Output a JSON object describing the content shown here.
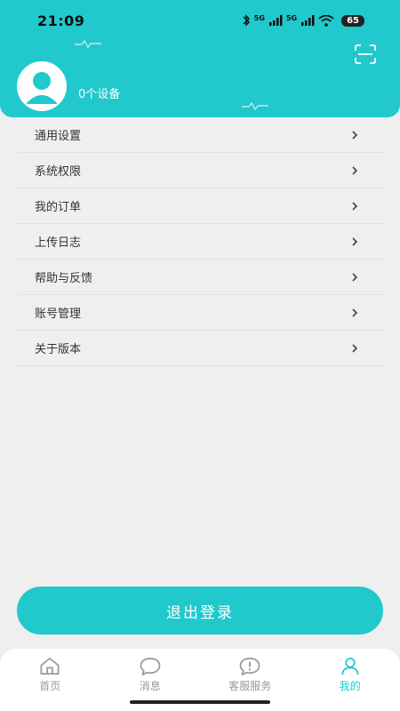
{
  "status_bar": {
    "time": "21:09",
    "signal": "5G",
    "battery": "65"
  },
  "profile": {
    "device_count": "0个设备"
  },
  "menu": {
    "items": [
      {
        "label": "通用设置"
      },
      {
        "label": "系统权限"
      },
      {
        "label": "我的订单"
      },
      {
        "label": "上传日志"
      },
      {
        "label": "帮助与反馈"
      },
      {
        "label": "账号管理"
      },
      {
        "label": "关于版本"
      }
    ]
  },
  "logout_label": "退出登录",
  "tabs": [
    {
      "label": "首页",
      "icon": "home-icon"
    },
    {
      "label": "消息",
      "icon": "message-icon"
    },
    {
      "label": "客服服务",
      "icon": "support-icon"
    },
    {
      "label": "我的",
      "icon": "profile-icon",
      "active": true
    }
  ],
  "colors": {
    "accent": "#21c8cc",
    "background": "#efefef",
    "tab_inactive": "#999999"
  }
}
